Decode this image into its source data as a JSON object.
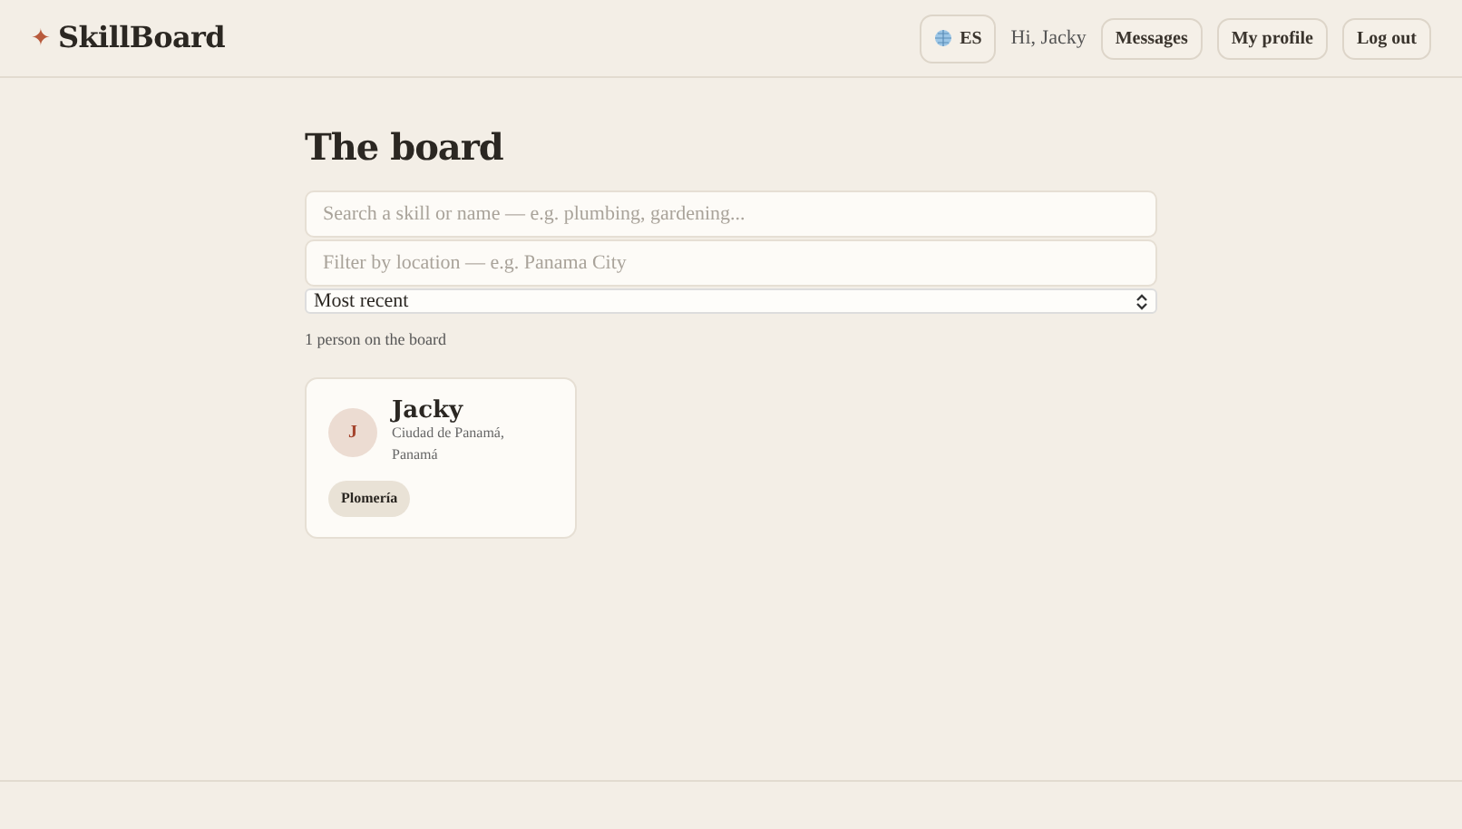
{
  "brand": {
    "mark": "✦",
    "name": "SkillBoard"
  },
  "nav": {
    "language": "ES",
    "greeting": "Hi, Jacky",
    "buttons": [
      "Messages",
      "My profile",
      "Log out"
    ]
  },
  "title": "The board",
  "search": {
    "placeholder": "Search a skill or name — e.g. plumbing, gardening..."
  },
  "location": {
    "placeholder": "Filter by location — e.g. Panama City"
  },
  "sort": {
    "value": "Most recent"
  },
  "count": "1 person on the board",
  "people": [
    {
      "initial": "J",
      "name": "Jacky",
      "location": "Ciudad de Panamá, Panamá",
      "skills": [
        "Plomería"
      ]
    }
  ]
}
